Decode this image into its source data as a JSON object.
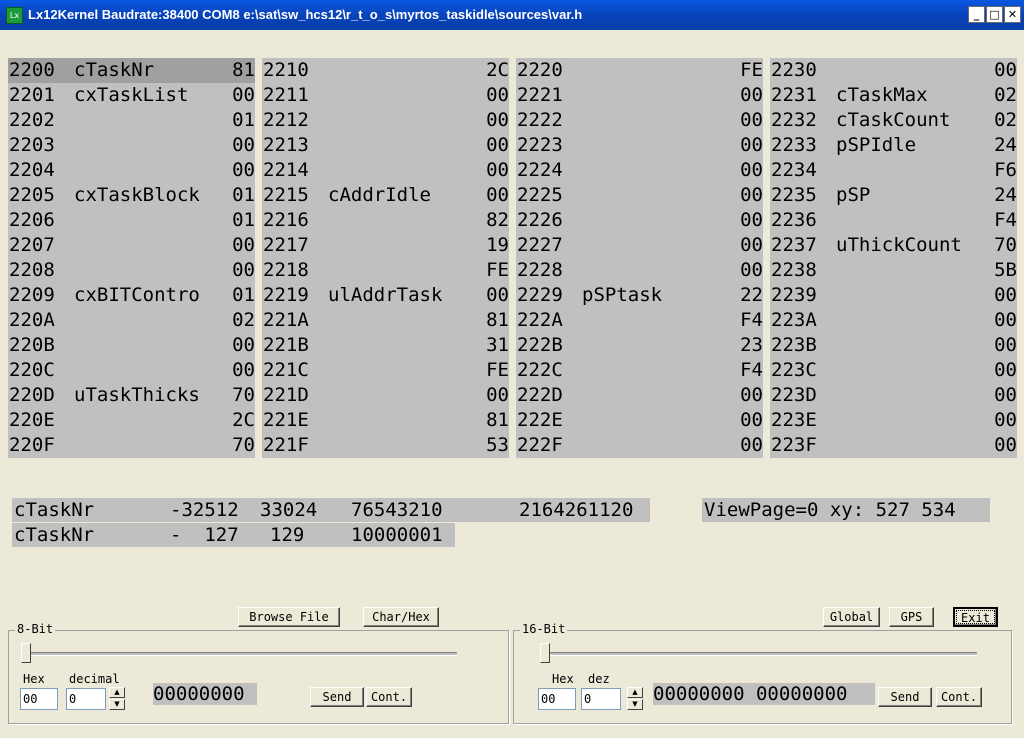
{
  "window": {
    "title": "Lx12Kernel Baudrate:38400 COM8  e:\\sat\\sw_hcs12\\r_t_o_s\\myrtos_taskidle\\sources\\var.h",
    "icon_text": "Lx",
    "minimize": "_",
    "maximize": "□",
    "close": "✕"
  },
  "memory": {
    "col0": [
      {
        "addr": "2200",
        "name": "cTaskNr",
        "val": "81"
      },
      {
        "addr": "2201",
        "name": "cxTaskList",
        "val": "00"
      },
      {
        "addr": "2202",
        "name": "",
        "val": "01"
      },
      {
        "addr": "2203",
        "name": "",
        "val": "00"
      },
      {
        "addr": "2204",
        "name": "",
        "val": "00"
      },
      {
        "addr": "2205",
        "name": "cxTaskBlock",
        "val": "01"
      },
      {
        "addr": "2206",
        "name": "",
        "val": "01"
      },
      {
        "addr": "2207",
        "name": "",
        "val": "00"
      },
      {
        "addr": "2208",
        "name": "",
        "val": "00"
      },
      {
        "addr": "2209",
        "name": "cxBITContro",
        "val": "01"
      },
      {
        "addr": "220A",
        "name": "",
        "val": "02"
      },
      {
        "addr": "220B",
        "name": "",
        "val": "00"
      },
      {
        "addr": "220C",
        "name": "",
        "val": "00"
      },
      {
        "addr": "220D",
        "name": "uTaskThicks",
        "val": "70"
      },
      {
        "addr": "220E",
        "name": "",
        "val": "2C"
      },
      {
        "addr": "220F",
        "name": "",
        "val": "70"
      }
    ],
    "col1": [
      {
        "addr": "2210",
        "name": "",
        "val": "2C"
      },
      {
        "addr": "2211",
        "name": "",
        "val": "00"
      },
      {
        "addr": "2212",
        "name": "",
        "val": "00"
      },
      {
        "addr": "2213",
        "name": "",
        "val": "00"
      },
      {
        "addr": "2214",
        "name": "",
        "val": "00"
      },
      {
        "addr": "2215",
        "name": "cAddrIdle",
        "val": "00"
      },
      {
        "addr": "2216",
        "name": "",
        "val": "82"
      },
      {
        "addr": "2217",
        "name": "",
        "val": "19"
      },
      {
        "addr": "2218",
        "name": "",
        "val": "FE"
      },
      {
        "addr": "2219",
        "name": "ulAddrTask",
        "val": "00"
      },
      {
        "addr": "221A",
        "name": "",
        "val": "81"
      },
      {
        "addr": "221B",
        "name": "",
        "val": "31"
      },
      {
        "addr": "221C",
        "name": "",
        "val": "FE"
      },
      {
        "addr": "221D",
        "name": "",
        "val": "00"
      },
      {
        "addr": "221E",
        "name": "",
        "val": "81"
      },
      {
        "addr": "221F",
        "name": "",
        "val": "53"
      }
    ],
    "col2": [
      {
        "addr": "2220",
        "name": "",
        "val": "FE"
      },
      {
        "addr": "2221",
        "name": "",
        "val": "00"
      },
      {
        "addr": "2222",
        "name": "",
        "val": "00"
      },
      {
        "addr": "2223",
        "name": "",
        "val": "00"
      },
      {
        "addr": "2224",
        "name": "",
        "val": "00"
      },
      {
        "addr": "2225",
        "name": "",
        "val": "00"
      },
      {
        "addr": "2226",
        "name": "",
        "val": "00"
      },
      {
        "addr": "2227",
        "name": "",
        "val": "00"
      },
      {
        "addr": "2228",
        "name": "",
        "val": "00"
      },
      {
        "addr": "2229",
        "name": "pSPtask",
        "val": "22"
      },
      {
        "addr": "222A",
        "name": "",
        "val": "F4"
      },
      {
        "addr": "222B",
        "name": "",
        "val": "23"
      },
      {
        "addr": "222C",
        "name": "",
        "val": "F4"
      },
      {
        "addr": "222D",
        "name": "",
        "val": "00"
      },
      {
        "addr": "222E",
        "name": "",
        "val": "00"
      },
      {
        "addr": "222F",
        "name": "",
        "val": "00"
      }
    ],
    "col3": [
      {
        "addr": "2230",
        "name": "",
        "val": "00"
      },
      {
        "addr": "2231",
        "name": "cTaskMax",
        "val": "02"
      },
      {
        "addr": "2232",
        "name": "cTaskCount",
        "val": "02"
      },
      {
        "addr": "2233",
        "name": "pSPIdle",
        "val": "24"
      },
      {
        "addr": "2234",
        "name": "",
        "val": "F6"
      },
      {
        "addr": "2235",
        "name": "pSP",
        "val": "24"
      },
      {
        "addr": "2236",
        "name": "",
        "val": "F4"
      },
      {
        "addr": "2237",
        "name": "uThickCount",
        "val": "70"
      },
      {
        "addr": "2238",
        "name": "",
        "val": "5B"
      },
      {
        "addr": "2239",
        "name": "",
        "val": "00"
      },
      {
        "addr": "223A",
        "name": "",
        "val": "00"
      },
      {
        "addr": "223B",
        "name": "",
        "val": "00"
      },
      {
        "addr": "223C",
        "name": "",
        "val": "00"
      },
      {
        "addr": "223D",
        "name": "",
        "val": "00"
      },
      {
        "addr": "223E",
        "name": "",
        "val": "00"
      },
      {
        "addr": "223F",
        "name": "",
        "val": "00"
      }
    ]
  },
  "info": {
    "line1": {
      "name": "cTaskNr",
      "v1": "-32512",
      "v2": "33024",
      "v3": "76543210",
      "v4": "2164261120"
    },
    "line2": {
      "name": "cTaskNr",
      "v1": "-  127",
      "v2": "129",
      "v3": "10000001"
    },
    "viewpage": "ViewPage=0 xy: 527 534"
  },
  "toolbar": {
    "browse": "Browse File",
    "charhex": "Char/Hex",
    "global": "Global",
    "gps": "GPS",
    "exit": "Exit"
  },
  "bit8": {
    "label": "8-Bit",
    "hex_label": "Hex",
    "dec_label": "decimal",
    "hex_value": "00",
    "dec_value": "0",
    "bits": "00000000",
    "send": "Send",
    "cont": "Cont.",
    "slider_level": 0
  },
  "bit16": {
    "label": "16-Bit",
    "hex_label": "Hex",
    "dec_label": "dez",
    "hex_value": "00",
    "dec_value": "0",
    "bits": "00000000 00000000",
    "send": "Send",
    "cont": "Cont.",
    "slider_level": 0
  }
}
